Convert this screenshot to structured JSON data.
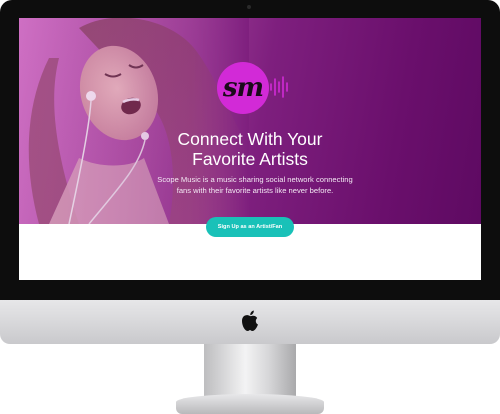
{
  "hero": {
    "heading_line1": "Connect With Your",
    "heading_line2": "Favorite Artists",
    "description": "Scope Music is a music sharing social network connecting fans with their favorite artists like never before.",
    "cta_label": "Sign Up as an Artist/Fan"
  },
  "logo": {
    "text": "sm"
  },
  "colors": {
    "brand_magenta": "#d22ad7",
    "hero_purple": "#6a0f6c",
    "cta_teal": "#19c1b8",
    "text_white": "#ffffff"
  },
  "icons": [
    "apple-logo-icon",
    "sound-waves-icon",
    "earphones-icon"
  ]
}
